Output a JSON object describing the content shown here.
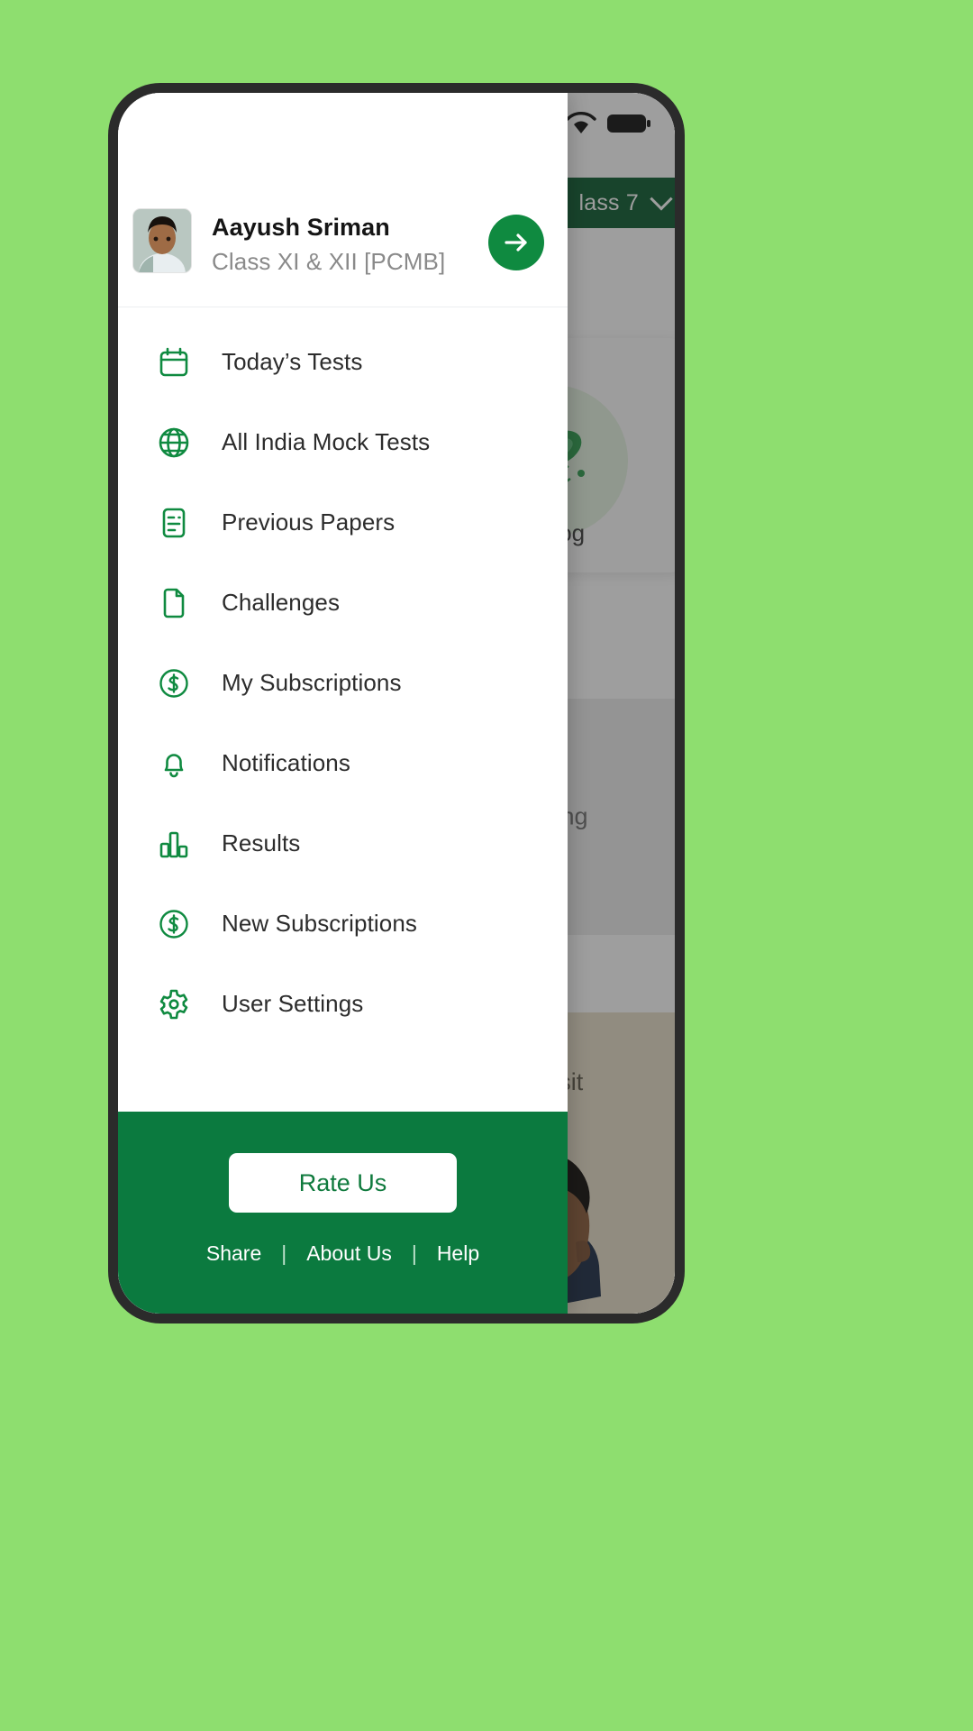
{
  "status_bar": {
    "signal_icon": "signal-icon",
    "wifi_icon": "wifi-icon",
    "battery_icon": "battery-icon"
  },
  "home_screen": {
    "class_selector": {
      "label": "lass 7",
      "chevron_icon": "chevron-down-icon"
    },
    "subject_card": {
      "label": "Biolog",
      "illustration_icon": "bacteria-icon"
    },
    "info_card": {
      "text": "iscing"
    },
    "photo_card": {
      "caption": "or sit",
      "photo_icon": "child-photo"
    }
  },
  "drawer": {
    "profile": {
      "avatar_icon": "avatar",
      "name": "Aayush Sriman",
      "subtitle": "Class XI & XII [PCMB]",
      "arrow_icon": "arrow-right-icon"
    },
    "menu_items": [
      {
        "label": "Today’s Tests",
        "icon": "calendar-icon"
      },
      {
        "label": "All India Mock Tests",
        "icon": "globe-icon"
      },
      {
        "label": "Previous Papers",
        "icon": "document-lines-icon"
      },
      {
        "label": "Challenges",
        "icon": "file-icon"
      },
      {
        "label": "My Subscriptions",
        "icon": "dollar-circle-icon"
      },
      {
        "label": "Notifications",
        "icon": "bell-icon"
      },
      {
        "label": "Results",
        "icon": "bar-chart-icon"
      },
      {
        "label": "New Subscriptions",
        "icon": "dollar-circle-icon"
      },
      {
        "label": "User Settings",
        "icon": "gear-icon"
      }
    ],
    "footer": {
      "rate_us_label": "Rate Us",
      "links": [
        "Share",
        "About Us",
        "Help"
      ],
      "separator": "|"
    }
  },
  "colors": {
    "page_background": "#8ede6f",
    "brand_green": "#0b7a3f",
    "icon_green": "#0f8a40",
    "dark_green": "#0c5c31",
    "footer_text": "#ffffff"
  }
}
